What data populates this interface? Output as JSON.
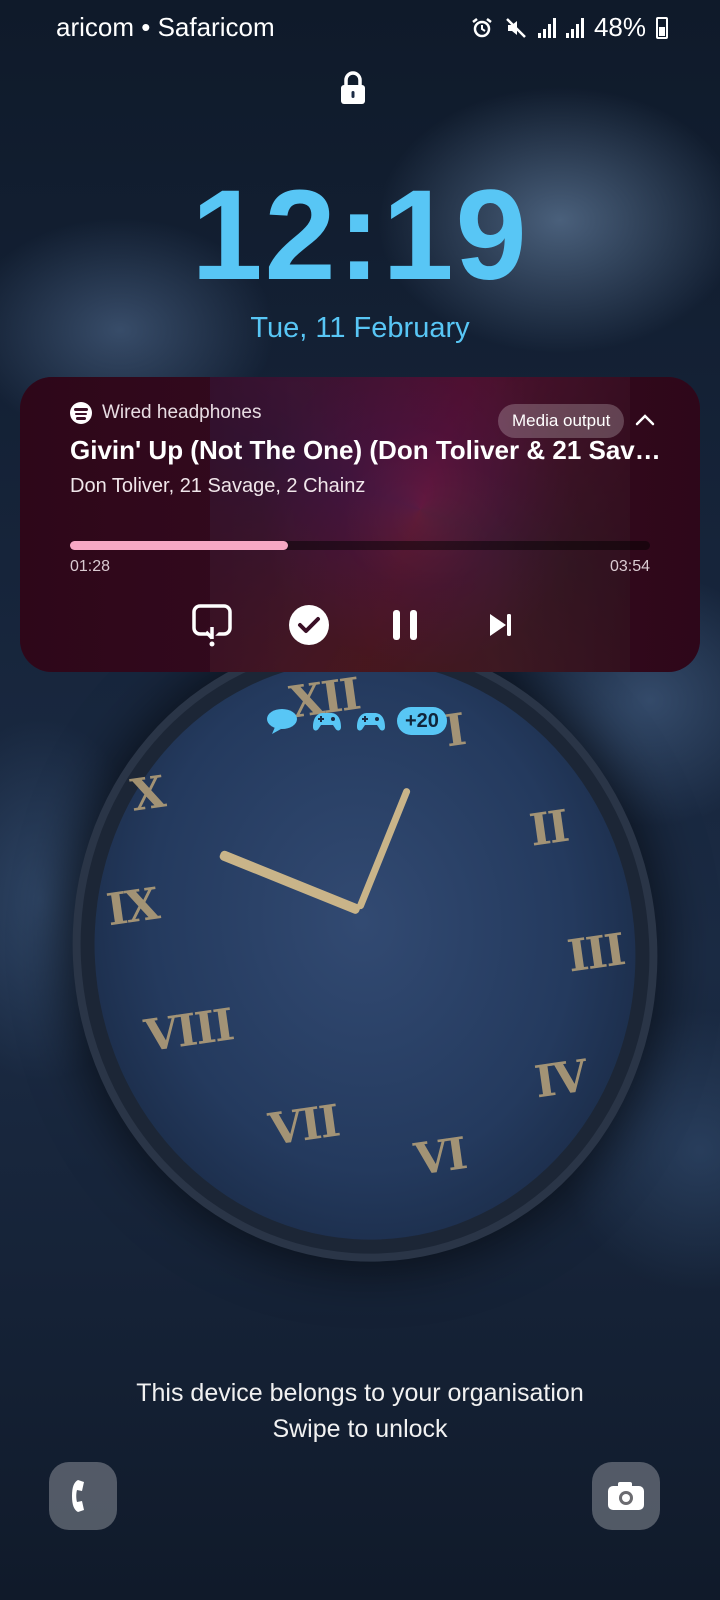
{
  "status_bar": {
    "carrier": "aricom • Safaricom",
    "battery": "48%",
    "icons": [
      "alarm-icon",
      "mute-icon",
      "signal-icon",
      "signal-icon",
      "battery-icon"
    ]
  },
  "lockscreen": {
    "time": "12:19",
    "date": "Tue, 11 February"
  },
  "media_player": {
    "source": "Wired headphones",
    "output_label": "Media output",
    "title": "Givin' Up (Not The One) (Don Toliver & 21 Savage...",
    "artist": "Don Toliver, 21 Savage, 2 Chainz",
    "elapsed": "01:28",
    "duration": "03:54",
    "progress_fraction": 0.376,
    "accent_color": "#f7a8c4",
    "controls": [
      "cast-icon",
      "check-icon",
      "pause-icon",
      "skip-next-icon"
    ]
  },
  "notifications": {
    "icons": [
      "chat-bubble-icon",
      "game-controller-icon",
      "game-controller-icon"
    ],
    "more_count": "+20"
  },
  "footer": {
    "owner_message": "This device belongs to your organisation",
    "unlock_hint": "Swipe to unlock",
    "shortcuts": [
      "phone-icon",
      "camera-icon"
    ]
  },
  "colors": {
    "clock": "#58c6f5",
    "card_background": "#3a0f26"
  }
}
